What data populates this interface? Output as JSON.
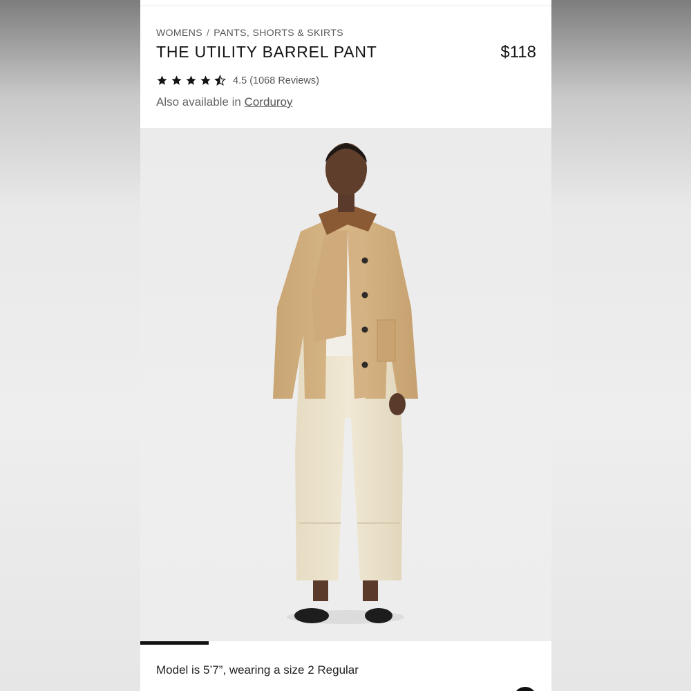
{
  "breadcrumb": {
    "items": [
      "WOMENS",
      "PANTS, SHORTS & SKIRTS"
    ],
    "separator": "/"
  },
  "product": {
    "title": "THE UTILITY BARREL PANT",
    "price": "$118",
    "rating_value": "4.5",
    "reviews_text": "(1068 Reviews)",
    "stars": [
      1,
      1,
      1,
      1,
      0.5
    ],
    "also_available_prefix": "Also available in",
    "also_available_link": "Corduroy"
  },
  "gallery": {
    "image_icon": "product-photo",
    "progress_fraction": 0.167
  },
  "caption": "Model is 5’7”, wearing a size 2 Regular",
  "colors": {
    "text_primary": "#141414",
    "text_secondary": "#555555",
    "progress": "#111111",
    "jacket": "#d2b07f",
    "pants": "#ece3cc"
  }
}
